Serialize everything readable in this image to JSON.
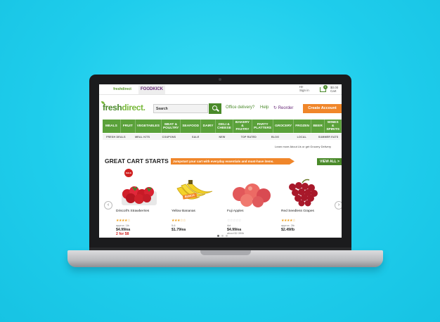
{
  "topbar": {
    "tab_freshdirect": "freshdirect",
    "tab_foodkick": "FOODKICK",
    "greeting": "Hi!",
    "sign_in": "Sign in",
    "cart_count": "0",
    "cart_amount": "$0.00",
    "cart_label": "Cart"
  },
  "header": {
    "logo_fresh": "fresh",
    "logo_direct": "direct.",
    "search_placeholder": "Search",
    "office_delivery": "Office delivery?",
    "help": "Help",
    "reorder": "Reorder",
    "create_account": "Create Account"
  },
  "nav": {
    "items": [
      "MEALS",
      "FRUIT",
      "VEGETABLES",
      "MEAT &\nPOULTRY",
      "SEAFOOD",
      "DAIRY",
      "DELI &\nCHEESE",
      "BAKERY &\nPASTRY",
      "PARTY\nPLATTERS",
      "GROCERY",
      "FROZEN",
      "BEER",
      "WINES &\nSPIRITS"
    ]
  },
  "subnav": {
    "items": [
      "FRESH DEALS",
      "MEAL KITS",
      "COUPONS",
      "SALE",
      "NEW",
      "TOP RATED",
      "BLOG",
      "LOCAL",
      "SUMMER EATS"
    ]
  },
  "learn_more": "Learn more About Us or get Grocery Delivery",
  "section": {
    "title": "GREAT CART STARTS",
    "promo": "Jumpstart your cart with everyday essentials and must-have items.",
    "view_all": "VIEW ALL >"
  },
  "products": [
    {
      "name": "Driscoll's Strawberries",
      "stars": "★★★★☆",
      "unit": "approx. 1lb",
      "price": "$4.99/ea",
      "extra": "2 for $8",
      "badge": "SALE"
    },
    {
      "name": "Yellow Bananas",
      "stars": "★★★☆☆",
      "unit": "5-6",
      "price": "$1.79/ea",
      "extra": "",
      "badge": "BUNCH"
    },
    {
      "name": "Fuji Apples",
      "stars": "☆☆☆☆☆",
      "unit": "4ct",
      "price": "$4.99/ea",
      "extra": "about $2.39/lb",
      "badge": ""
    },
    {
      "name": "Red Seedless Grapes",
      "stars": "★★★★☆",
      "unit": "approx. 2lb",
      "price": "$2.49/lb",
      "extra": "",
      "badge": ""
    }
  ],
  "colors": {
    "brand_green": "#5aa13a",
    "accent_orange": "#f0862a",
    "background": "#1fd0ef"
  }
}
